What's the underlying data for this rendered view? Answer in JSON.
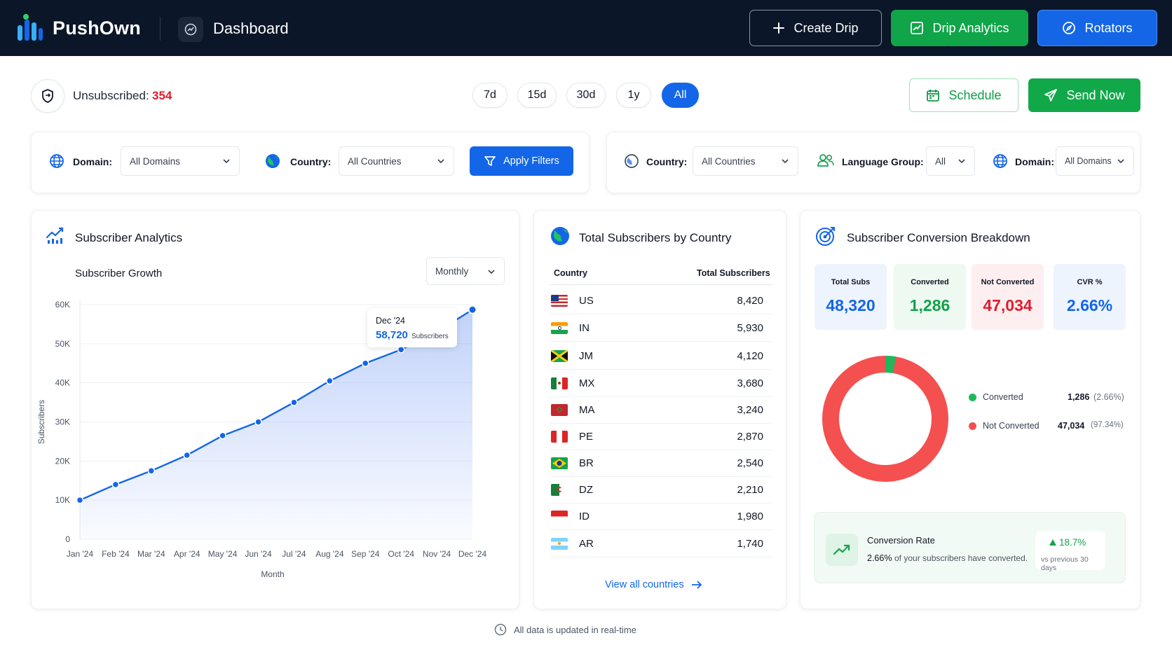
{
  "header": {
    "app_name": "PushOwn",
    "page_title": "Dashboard",
    "create_drip": "Create Drip",
    "drip_analytics": "Drip Analytics",
    "rotators": "Rotators"
  },
  "toolbar": {
    "unsubscribed_label": "Unsubscribed:",
    "unsubscribed_value": "354",
    "ranges": [
      "7d",
      "15d",
      "30d",
      "1y",
      "All"
    ],
    "active_range": "All",
    "schedule": "Schedule",
    "send_now": "Send Now"
  },
  "filters_left": {
    "domain_label": "Domain:",
    "domain_value": "All Domains",
    "country_label": "Country:",
    "country_value": "All Countries",
    "apply": "Apply Filters"
  },
  "filters_right": {
    "country_label": "Country:",
    "country_value": "All Countries",
    "language_label": "Language Group:",
    "language_value": "All",
    "domain_label": "Domain:",
    "domain_value": "All Domains"
  },
  "analytics": {
    "title": "Subscriber Analytics",
    "subtitle": "Subscriber Growth",
    "period": "Monthly",
    "tooltip_month": "Dec '24",
    "tooltip_value": "58,720",
    "tooltip_unit": "Subscribers"
  },
  "chart_data": {
    "type": "area",
    "x": [
      "Jan '24",
      "Feb '24",
      "Mar '24",
      "Apr '24",
      "May '24",
      "Jun '24",
      "Jul '24",
      "Aug '24",
      "Sep '24",
      "Oct '24",
      "Nov '24",
      "Dec '24"
    ],
    "values": [
      10000,
      14000,
      17500,
      21500,
      26500,
      30000,
      35000,
      40500,
      45000,
      48500,
      53000,
      58720
    ],
    "xlabel": "Month",
    "ylabel": "Subscribers",
    "ylim": [
      0,
      60000
    ],
    "yticks": [
      "0",
      "10K",
      "20K",
      "30K",
      "40K",
      "50K",
      "60K"
    ],
    "grid": true
  },
  "countries": {
    "title": "Total Subscribers by Country",
    "col_country": "Country",
    "col_total": "Total Subscribers",
    "rows": [
      {
        "code": "US",
        "value": "8,420"
      },
      {
        "code": "IN",
        "value": "5,930"
      },
      {
        "code": "JM",
        "value": "4,120"
      },
      {
        "code": "MX",
        "value": "3,680"
      },
      {
        "code": "MA",
        "value": "3,240"
      },
      {
        "code": "PE",
        "value": "2,870"
      },
      {
        "code": "BR",
        "value": "2,540"
      },
      {
        "code": "DZ",
        "value": "2,210"
      },
      {
        "code": "ID",
        "value": "1,980"
      },
      {
        "code": "AR",
        "value": "1,740"
      }
    ],
    "view_all": "View all countries"
  },
  "conversion": {
    "title": "Subscriber Conversion Breakdown",
    "tiles": [
      {
        "label": "Total Subs",
        "value": "48,320",
        "color": "#1366e8",
        "bg": "#eef4fe"
      },
      {
        "label": "Converted",
        "value": "1,286",
        "color": "#13a24b",
        "bg": "#edf9f1"
      },
      {
        "label": "Not Converted",
        "value": "47,034",
        "color": "#e11d2e",
        "bg": "#fdeff0"
      },
      {
        "label": "CVR %",
        "value": "2.66%",
        "color": "#1366e8",
        "bg": "#eef4fe"
      }
    ],
    "donut": {
      "converted_fraction": 0.0266,
      "converted_color": "#1fb85a",
      "not_converted_color": "#f4504f"
    },
    "legend": [
      {
        "label": "Converted",
        "value": "1,286",
        "pct": "(2.66%)"
      },
      {
        "label": "Not Converted",
        "value": "47,034",
        "pct": "(97.34%)"
      }
    ],
    "rate_title": "Conversion Rate",
    "rate_value": "2.66%",
    "rate_text": "of your subscribers have converted.",
    "rate_change": "18.7%",
    "rate_compare": "vs previous 30 days"
  },
  "footer": {
    "note": "All data is updated in real-time"
  }
}
